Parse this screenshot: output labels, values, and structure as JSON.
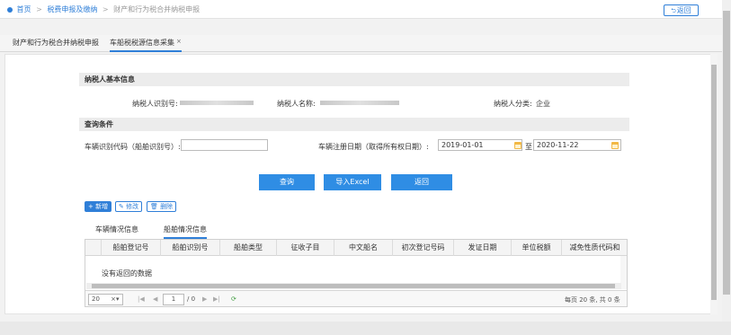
{
  "breadcrumb": {
    "home": "首页",
    "level1": "税费申报及缴纳",
    "level2": "财产和行为税合并纳税申报",
    "separator": ">"
  },
  "back_button": "返回",
  "page_tabs": {
    "tab1": "财产和行为税合并纳税申报",
    "tab2": "车船税税源信息采集",
    "close_glyph": "×"
  },
  "section_basic": {
    "title": "纳税人基本信息",
    "taxpayer_id_label": "纳税人识别号:",
    "taxpayer_name_label": "纳税人名称:",
    "taxpayer_type_label": "纳税人分类:",
    "taxpayer_type_value": "企业"
  },
  "section_query": {
    "title": "查询条件",
    "vin_label": "车辆识别代码（船舶识别号）:",
    "vin_value": "",
    "reg_date_label": "车辆注册日期（取得所有权日期）:",
    "date_from": "2019-01-01",
    "date_to_sep": "至",
    "date_to": "2020-11-22"
  },
  "actions": {
    "query": "查询",
    "import": "导入Excel",
    "back": "返回"
  },
  "toolbar": {
    "add": "+ 新增",
    "edit": "修改",
    "delete": "删除"
  },
  "sub_tabs": {
    "vehicle": "车辆情况信息",
    "vessel": "船舶情况信息"
  },
  "grid": {
    "columns": [
      "船舶登记号",
      "船舶识别号",
      "船舶类型",
      "征收子目",
      "中文船名",
      "初次登记号码",
      "发证日期",
      "单位税额",
      "减免性质代码和"
    ],
    "no_data": "没有返回的数据"
  },
  "pager": {
    "page_size": "20",
    "page_input": "1",
    "page_total": "/ 0",
    "summary": "每页 20 条, 共 0 条"
  },
  "colors": {
    "accent": "#2f7fd8",
    "button": "#2f8de4",
    "calendar": "#f2b845"
  }
}
